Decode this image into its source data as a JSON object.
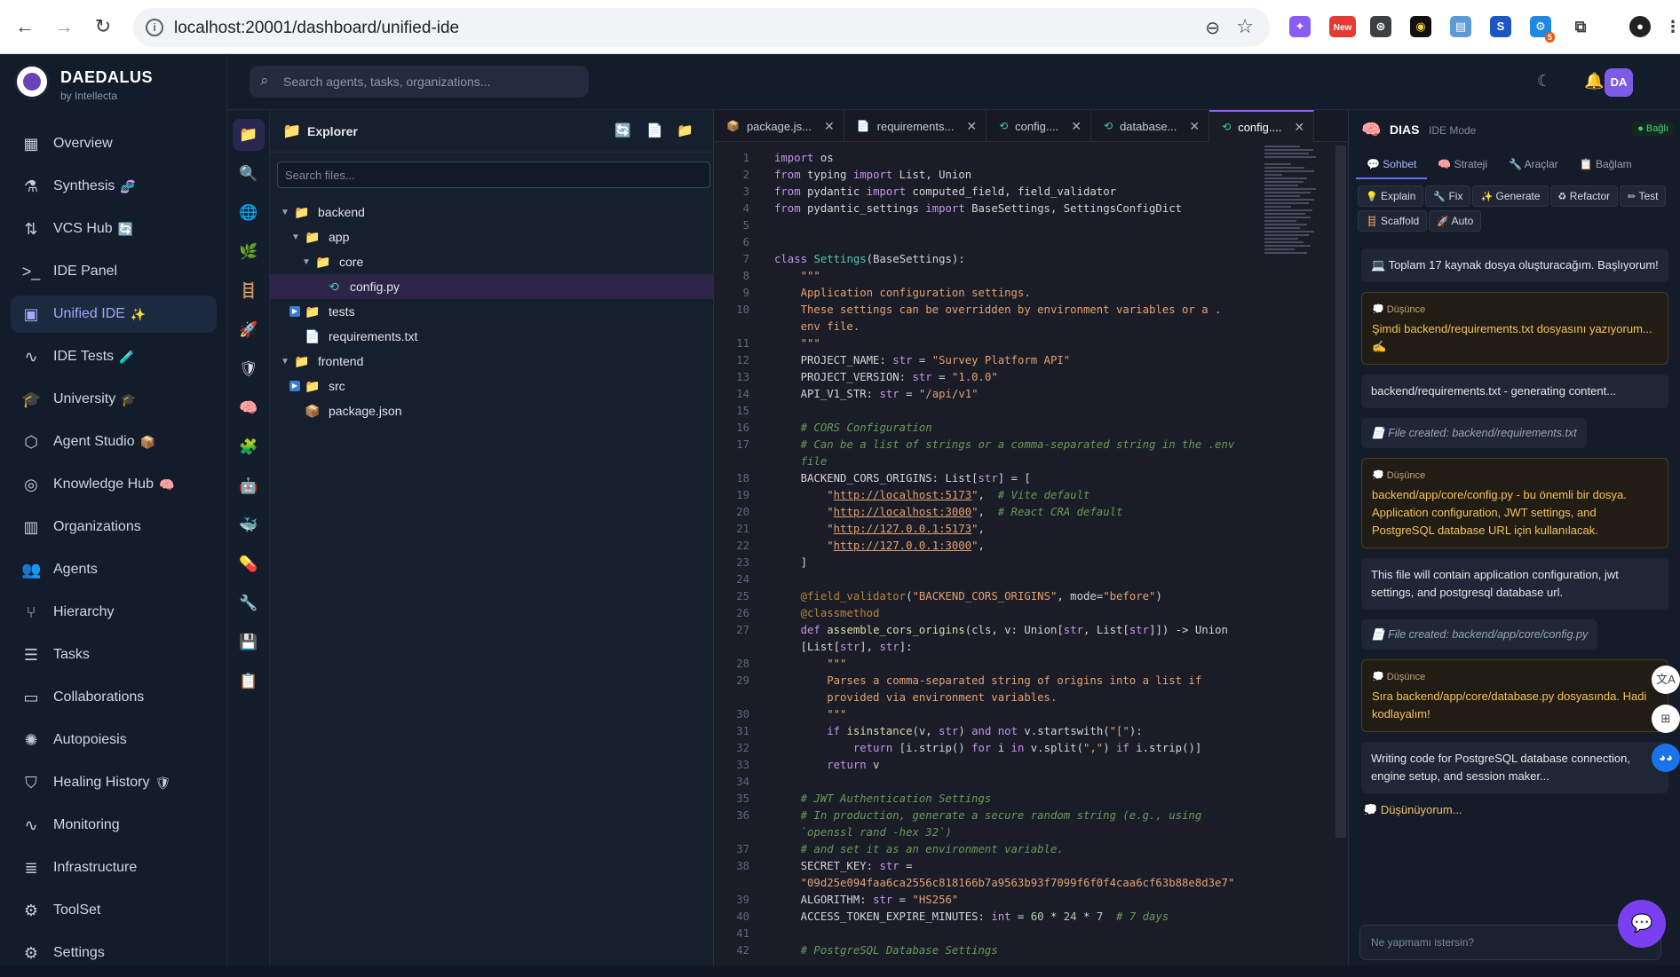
{
  "browser": {
    "url": "localhost:20001/dashboard/unified-ide",
    "new_badge": "New",
    "ext_badge_count": "5",
    "ext_s": "S"
  },
  "brand": {
    "name": "DAEDALUS",
    "sub": "by Intellecta"
  },
  "search": {
    "placeholder": "Search agents, tasks, organizations..."
  },
  "user": {
    "initials": "DA"
  },
  "sidebar": {
    "items": [
      {
        "label": "Overview",
        "icon": "grid-icon"
      },
      {
        "label": "Synthesis",
        "icon": "molecule-icon",
        "emoji": "🧬"
      },
      {
        "label": "VCS Hub",
        "icon": "branch-icon",
        "emoji": "🔄"
      },
      {
        "label": "IDE Panel",
        "icon": "terminal-icon"
      },
      {
        "label": "Unified IDE",
        "icon": "cpu-icon",
        "emoji": "✨"
      },
      {
        "label": "IDE Tests",
        "icon": "pulse-icon",
        "emoji": "🧪"
      },
      {
        "label": "University",
        "icon": "graduation-icon",
        "emoji": "🎓"
      },
      {
        "label": "Agent Studio",
        "icon": "cube-icon",
        "emoji": "📦"
      },
      {
        "label": "Knowledge Hub",
        "icon": "brain-icon",
        "emoji": "🧠"
      },
      {
        "label": "Organizations",
        "icon": "building-icon"
      },
      {
        "label": "Agents",
        "icon": "users-icon"
      },
      {
        "label": "Hierarchy",
        "icon": "hierarchy-icon"
      },
      {
        "label": "Tasks",
        "icon": "list-icon"
      },
      {
        "label": "Collaborations",
        "icon": "chat-icon"
      },
      {
        "label": "Autopoiesis",
        "icon": "sparkle-icon"
      },
      {
        "label": "Healing History",
        "icon": "shield-icon",
        "emoji": "🛡"
      },
      {
        "label": "Monitoring",
        "icon": "activity-icon"
      },
      {
        "label": "Infrastructure",
        "icon": "server-icon"
      },
      {
        "label": "ToolSet",
        "icon": "gear-icon"
      },
      {
        "label": "Settings",
        "icon": "settings-icon"
      }
    ]
  },
  "explorer": {
    "title": "Explorer",
    "search_placeholder": "Search files...",
    "tree": [
      {
        "name": "backend",
        "type": "folder",
        "depth": 0,
        "open": true
      },
      {
        "name": "app",
        "type": "folder",
        "depth": 1,
        "open": true
      },
      {
        "name": "core",
        "type": "folder",
        "depth": 2,
        "open": true
      },
      {
        "name": "config.py",
        "type": "file-py",
        "depth": 3,
        "selected": true
      },
      {
        "name": "tests",
        "type": "folder",
        "depth": 1,
        "open": false
      },
      {
        "name": "requirements.txt",
        "type": "file-txt",
        "depth": 1
      },
      {
        "name": "frontend",
        "type": "folder",
        "depth": 0,
        "open": true
      },
      {
        "name": "src",
        "type": "folder",
        "depth": 1,
        "open": false
      },
      {
        "name": "package.json",
        "type": "file-json",
        "depth": 1
      }
    ]
  },
  "editor": {
    "tabs": [
      {
        "label": "package.js...",
        "icon": "package-icon"
      },
      {
        "label": "requirements...",
        "icon": "file-icon"
      },
      {
        "label": "config....",
        "icon": "python-icon"
      },
      {
        "label": "database...",
        "icon": "python-icon"
      },
      {
        "label": "config....",
        "icon": "python-icon",
        "active": true
      }
    ],
    "lines": [
      {
        "n": "1",
        "html": "<span class=\"kw\">import</span> os"
      },
      {
        "n": "2",
        "html": "<span class=\"kw\">from</span> typing <span class=\"kw\">import</span> List, Union"
      },
      {
        "n": "3",
        "html": "<span class=\"kw\">from</span> pydantic <span class=\"kw\">import</span> computed_field, field_validator"
      },
      {
        "n": "4",
        "html": "<span class=\"kw\">from</span> pydantic_settings <span class=\"kw\">import</span> BaseSettings, SettingsConfigDict"
      },
      {
        "n": "5",
        "html": ""
      },
      {
        "n": "6",
        "html": ""
      },
      {
        "n": "7",
        "html": "<span class=\"kw\">class</span> <span class=\"cls\">Settings</span>(BaseSettings):"
      },
      {
        "n": "8",
        "html": "    <span class=\"str\">\"\"\"</span>"
      },
      {
        "n": "9",
        "html": "<span class=\"str\">    Application configuration settings.</span>"
      },
      {
        "n": "10",
        "html": "<span class=\"str\">    These settings can be overridden by environment variables or a .</span>"
      },
      {
        "n": "",
        "html": "<span class=\"str\">    env file.</span>"
      },
      {
        "n": "11",
        "html": "<span class=\"str\">    \"\"\"</span>"
      },
      {
        "n": "12",
        "html": "    PROJECT_NAME: <span class=\"kw\">str</span> = <span class=\"str\">\"Survey Platform API\"</span>"
      },
      {
        "n": "13",
        "html": "    PROJECT_VERSION: <span class=\"kw\">str</span> = <span class=\"str\">\"1.0.0\"</span>"
      },
      {
        "n": "14",
        "html": "    API_V1_STR: <span class=\"kw\">str</span> = <span class=\"str\">\"/api/v1\"</span>"
      },
      {
        "n": "15",
        "html": ""
      },
      {
        "n": "16",
        "html": "    <span class=\"cm\"># CORS Configuration</span>"
      },
      {
        "n": "17",
        "html": "    <span class=\"cm\"># Can be a list of strings or a comma-separated string in the .env</span>"
      },
      {
        "n": "",
        "html": "<span class=\"cm\">    file</span>"
      },
      {
        "n": "18",
        "html": "    BACKEND_CORS_ORIGINS: List[<span class=\"kw\">str</span>] = ["
      },
      {
        "n": "19",
        "html": "        <span class=\"str\">\"<u>http://localhost:5173</u>\"</span>,  <span class=\"cm\"># Vite default</span>"
      },
      {
        "n": "20",
        "html": "        <span class=\"str\">\"<u>http://localhost:3000</u>\"</span>,  <span class=\"cm\"># React CRA default</span>"
      },
      {
        "n": "21",
        "html": "        <span class=\"str\">\"<u>http://127.0.0.1:5173</u>\"</span>,"
      },
      {
        "n": "22",
        "html": "        <span class=\"str\">\"<u>http://127.0.0.1:3000</u>\"</span>,"
      },
      {
        "n": "23",
        "html": "    ]"
      },
      {
        "n": "24",
        "html": ""
      },
      {
        "n": "25",
        "html": "    <span class=\"dc\">@field_validator</span>(<span class=\"str\">\"BACKEND_CORS_ORIGINS\"</span>, mode=<span class=\"str\">\"before\"</span>)"
      },
      {
        "n": "26",
        "html": "    <span class=\"dc\">@classmethod</span>"
      },
      {
        "n": "27",
        "html": "    <span class=\"kw\">def</span> <span class=\"fn\">assemble_cors_origins</span>(cls, v: Union[<span class=\"kw\">str</span>, List[<span class=\"kw\">str</span>]]) -> Union"
      },
      {
        "n": "",
        "html": "    [List[<span class=\"kw\">str</span>], <span class=\"kw\">str</span>]:"
      },
      {
        "n": "28",
        "html": "        <span class=\"str\">\"\"\"</span>"
      },
      {
        "n": "29",
        "html": "<span class=\"str\">        Parses a comma-separated string of origins into a list if</span>"
      },
      {
        "n": "",
        "html": "<span class=\"str\">        provided via environment variables.</span>"
      },
      {
        "n": "30",
        "html": "<span class=\"str\">        \"\"\"</span>"
      },
      {
        "n": "31",
        "html": "        <span class=\"kw\">if</span> <span class=\"fn\">isinstance</span>(v, <span class=\"kw\">str</span>) <span class=\"kw\">and not</span> v.startswith(<span class=\"str\">\"[\"</span>):"
      },
      {
        "n": "32",
        "html": "            <span class=\"kw\">return</span> [i.strip() <span class=\"kw\">for</span> i <span class=\"kw\">in</span> v.split(<span class=\"str\">\",\"</span>) <span class=\"kw\">if</span> i.strip()]"
      },
      {
        "n": "33",
        "html": "        <span class=\"kw\">return</span> v"
      },
      {
        "n": "34",
        "html": ""
      },
      {
        "n": "35",
        "html": "    <span class=\"cm\"># JWT Authentication Settings</span>"
      },
      {
        "n": "36",
        "html": "    <span class=\"cm\"># In production, generate a secure random string (e.g., using</span>"
      },
      {
        "n": "",
        "html": "<span class=\"cm\">    `openssl rand -hex 32`)</span>"
      },
      {
        "n": "37",
        "html": "    <span class=\"cm\"># and set it as an environment variable.</span>"
      },
      {
        "n": "38",
        "html": "    SECRET_KEY: <span class=\"kw\">str</span> ="
      },
      {
        "n": "",
        "html": "    <span class=\"str\">\"09d25e094faa6ca2556c818166b7a9563b93f7099f6f0f4caa6cf63b88e8d3e7\"</span>"
      },
      {
        "n": "39",
        "html": "    ALGORITHM: <span class=\"kw\">str</span> = <span class=\"str\">\"HS256\"</span>"
      },
      {
        "n": "40",
        "html": "    ACCESS_TOKEN_EXPIRE_MINUTES: <span class=\"kw\">int</span> = <span class=\"num\">60</span> * <span class=\"num\">24</span> * <span class=\"num\">7</span>  <span class=\"cm\"># 7 days</span>"
      },
      {
        "n": "41",
        "html": ""
      },
      {
        "n": "42",
        "html": "    <span class=\"cm\"># PostgreSQL Database Settings</span>"
      }
    ]
  },
  "chat": {
    "title": "DIAS",
    "mode": "IDE Mode",
    "status": "Bağlı",
    "tabs": [
      "Sohbet",
      "Strateji",
      "Araçlar",
      "Bağlam"
    ],
    "quick_actions": [
      "Explain",
      "Fix",
      "Generate",
      "Refactor",
      "Test",
      "Scaffold",
      "Auto"
    ],
    "think_label": "Düşünce",
    "messages": [
      {
        "type": "plain",
        "text": "💻 Toplam 17 kaynak dosya oluşturacağım. Başlıyorum!"
      },
      {
        "type": "think",
        "text": "Şimdi backend/requirements.txt dosyasını yazıyorum... ✍️"
      },
      {
        "type": "plain",
        "text": "backend/requirements.txt - generating content..."
      },
      {
        "type": "file",
        "text": "File created: backend/requirements.txt"
      },
      {
        "type": "think",
        "text": "backend/app/core/config.py - bu önemli bir dosya. Application configuration, JWT settings, and PostgreSQL database URL için kullanılacak."
      },
      {
        "type": "plain",
        "text": "This file will contain application configuration, jwt settings, and postgresql database url."
      },
      {
        "type": "file",
        "text": "File created: backend/app/core/config.py"
      },
      {
        "type": "think",
        "text": "Sıra backend/app/core/database.py dosyasında. Hadi kodlayalım!"
      },
      {
        "type": "plain",
        "text": "Writing code for PostgreSQL database connection, engine setup, and session maker..."
      }
    ],
    "thinking": "Düşünüyorum...",
    "input_placeholder": "Ne yapmamı istersin?"
  }
}
